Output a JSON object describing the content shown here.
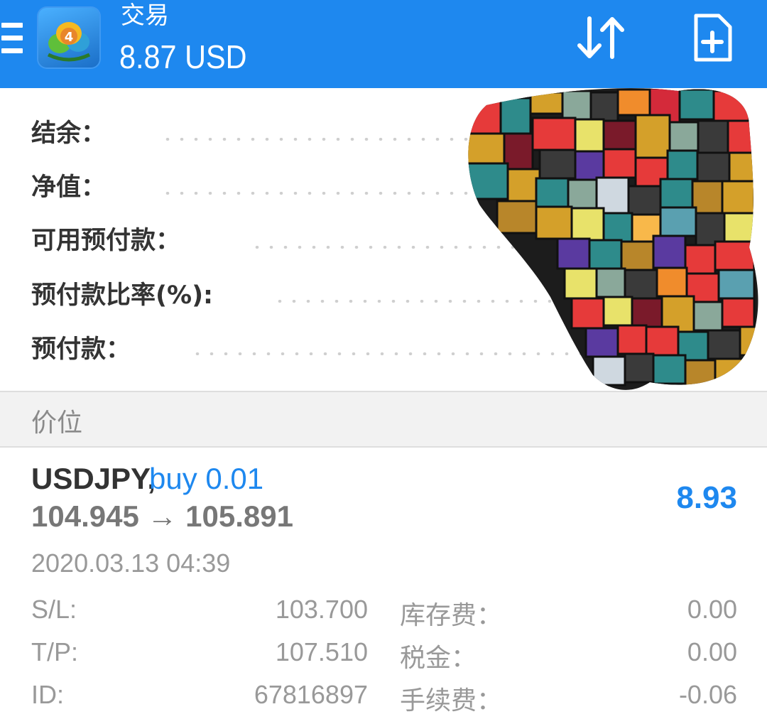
{
  "header": {
    "title": "交易",
    "balance": "8.87 USD",
    "logo_badge": "4"
  },
  "account": {
    "balance_label": "结余：",
    "equity_label": "净值：",
    "free_margin_label": "可用预付款：",
    "margin_level_label": "预付款比率(%):",
    "margin_label": "预付款："
  },
  "positions": {
    "section_title": "价位",
    "items": [
      {
        "symbol": "USDJPY,",
        "type": "buy 0.01",
        "prices": "104.945 → 105.891",
        "profit": "8.93",
        "time": "2020.03.13 04:39",
        "sl_label": "S/L:",
        "sl_value": "103.700",
        "tp_label": "T/P:",
        "tp_value": "107.510",
        "id_label": "ID:",
        "id_value": "67816897",
        "swap_label": "库存费：",
        "swap_value": "0.00",
        "taxes_label": "税金：",
        "taxes_value": "0.00",
        "commission_label": "手续费：",
        "commission_value": "-0.06"
      }
    ]
  },
  "colors": {
    "accent": "#1e88ef",
    "text_dark": "#333333",
    "text_muted": "#999999"
  },
  "icons": {
    "menu": "menu-icon",
    "sort": "sort-icon",
    "new_order": "new-order-icon"
  }
}
